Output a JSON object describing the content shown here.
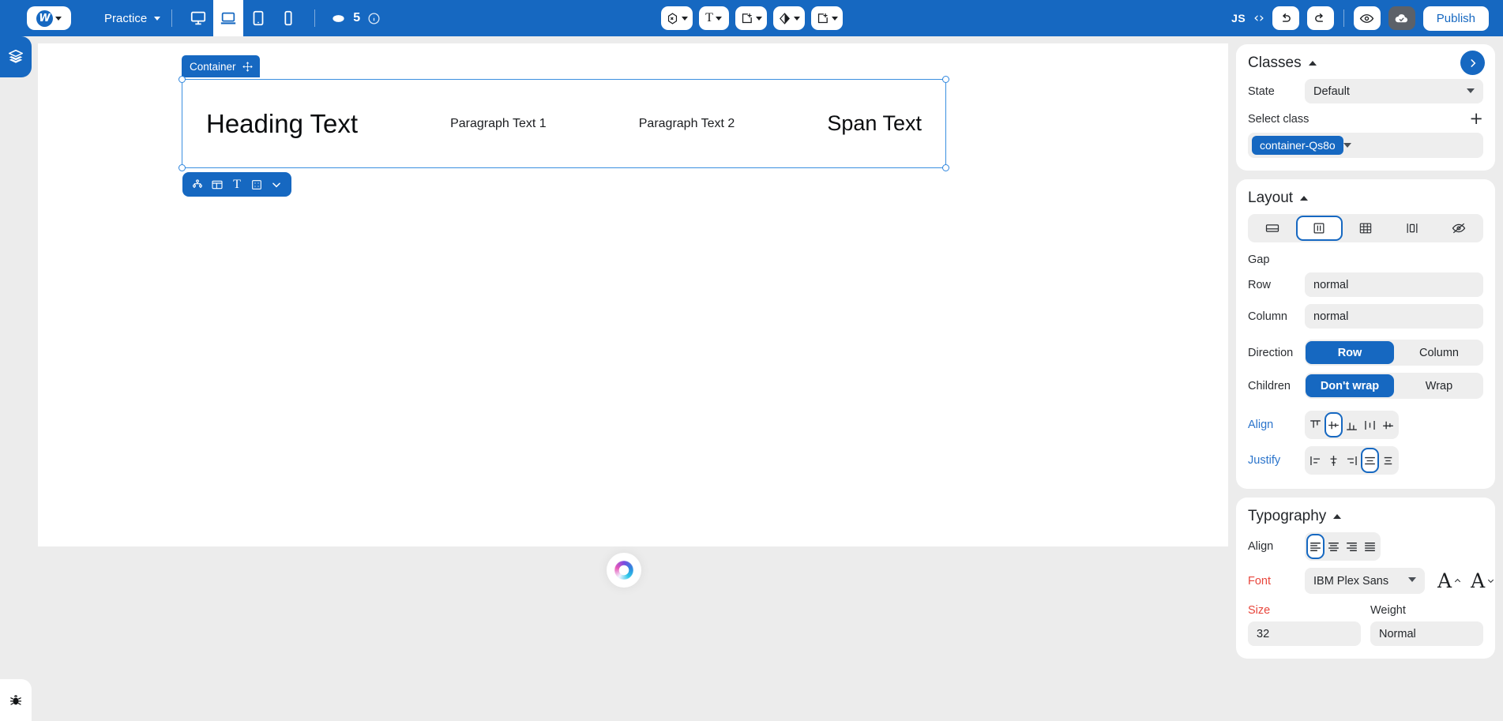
{
  "topbar": {
    "logo_letter": "W",
    "site_name": "Practice",
    "breakpoints": [
      {
        "name": "desktop",
        "icon": "monitor-icon",
        "active": false
      },
      {
        "name": "laptop",
        "icon": "laptop-icon",
        "active": true
      },
      {
        "name": "tablet",
        "icon": "tablet-icon",
        "active": false
      },
      {
        "name": "mobile",
        "icon": "mobile-icon",
        "active": false
      }
    ],
    "pages_count": "5",
    "center_tools": [
      {
        "name": "components-dropdown",
        "icon": "component-icon"
      },
      {
        "name": "text-dropdown",
        "icon": "text-T-icon"
      },
      {
        "name": "add-element-dropdown",
        "icon": "add-box-icon"
      },
      {
        "name": "style-dropdown",
        "icon": "contrast-diamond-icon"
      },
      {
        "name": "insert-dropdown",
        "icon": "add-box-icon"
      }
    ],
    "js_label": "JS",
    "code_label": "‹›",
    "undo_label": "undo-icon",
    "redo_label": "redo-icon",
    "preview_label": "eye-icon",
    "save_label": "cloud-check-icon",
    "publish_label": "Publish"
  },
  "leftrail": {
    "layers_icon": "layers-icon",
    "bug_icon": "bug-icon"
  },
  "canvas": {
    "selected_tag": "Container",
    "move_icon": "move-arrows-icon",
    "element_toolbar": [
      {
        "name": "structure-icon"
      },
      {
        "name": "columns-layout-icon"
      },
      {
        "name": "text-T-icon"
      },
      {
        "name": "padding-box-icon"
      },
      {
        "name": "chevron-down-icon"
      }
    ],
    "children": [
      {
        "type": "heading",
        "text": "Heading Text"
      },
      {
        "type": "paragraph",
        "text": "Paragraph Text 1"
      },
      {
        "type": "paragraph",
        "text": "Paragraph Text 2"
      },
      {
        "type": "span",
        "text": "Span Text"
      }
    ],
    "spinner": "ai-loading-spinner"
  },
  "panel": {
    "classes": {
      "title": "Classes",
      "expand_icon": "chevron-right-icon",
      "state_label": "State",
      "state_value": "Default",
      "select_class_label": "Select class",
      "add_class_icon": "plus-icon",
      "active_class": "container-Qs8o"
    },
    "layout": {
      "title": "Layout",
      "display_modes": [
        {
          "name": "block",
          "icon": "block-icon",
          "selected": false
        },
        {
          "name": "flex",
          "icon": "flex-icon",
          "selected": true
        },
        {
          "name": "grid",
          "icon": "grid-icon",
          "selected": false
        },
        {
          "name": "inline-block",
          "icon": "inline-block-icon",
          "selected": false
        },
        {
          "name": "none",
          "icon": "eye-off-icon",
          "selected": false
        }
      ],
      "gap_label": "Gap",
      "row_label": "Row",
      "row_value": "normal",
      "column_label": "Column",
      "column_value": "normal",
      "direction_label": "Direction",
      "direction_options": [
        {
          "label": "Row",
          "selected": true
        },
        {
          "label": "Column",
          "selected": false
        }
      ],
      "children_label": "Children",
      "children_options": [
        {
          "label": "Don't wrap",
          "selected": true
        },
        {
          "label": "Wrap",
          "selected": false
        }
      ],
      "align_label": "Align",
      "align_options": [
        {
          "name": "align-start",
          "selected": false
        },
        {
          "name": "align-center",
          "selected": true
        },
        {
          "name": "align-end",
          "selected": false
        },
        {
          "name": "align-stretch",
          "selected": false
        },
        {
          "name": "align-baseline",
          "selected": false
        }
      ],
      "justify_label": "Justify",
      "justify_options": [
        {
          "name": "justify-start",
          "selected": false
        },
        {
          "name": "justify-center",
          "selected": false
        },
        {
          "name": "justify-end",
          "selected": false
        },
        {
          "name": "justify-space-between",
          "selected": true
        },
        {
          "name": "justify-space-around",
          "selected": false
        }
      ]
    },
    "typography": {
      "title": "Typography",
      "align_label": "Align",
      "align_options": [
        {
          "name": "text-align-left",
          "selected": true
        },
        {
          "name": "text-align-center",
          "selected": false
        },
        {
          "name": "text-align-right",
          "selected": false
        },
        {
          "name": "text-align-justify",
          "selected": false
        }
      ],
      "font_label": "Font",
      "font_value": "IBM Plex Sans",
      "font_increase": "A",
      "font_decrease": "A",
      "size_label": "Size",
      "size_value": "32",
      "weight_label": "Weight",
      "weight_value": "Normal"
    }
  }
}
